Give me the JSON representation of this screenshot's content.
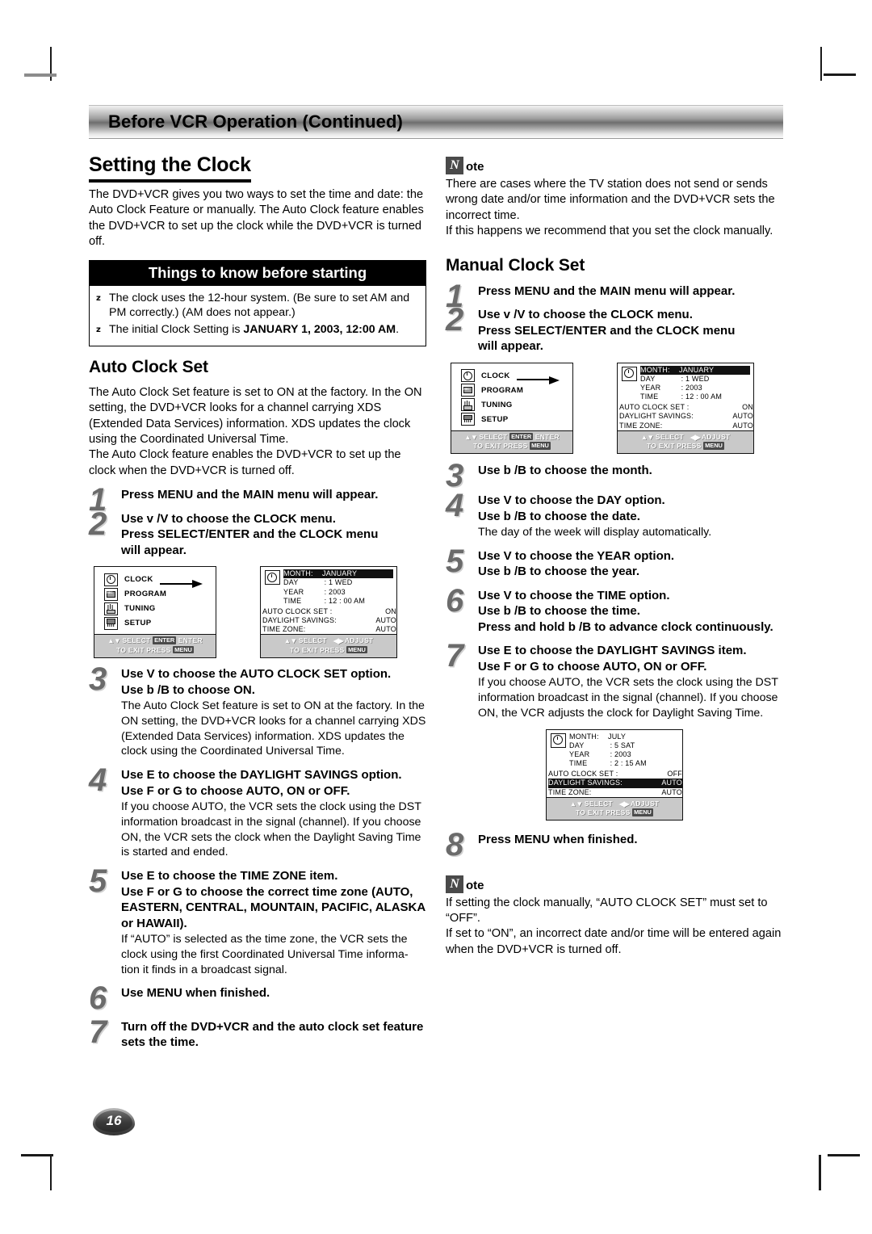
{
  "banner": {
    "title": "Before VCR Operation (Continued)"
  },
  "left": {
    "section_title": "Setting the Clock",
    "intro": "The DVD+VCR gives you two ways to set the time and date: the Auto Clock Feature or manually. The Auto Clock feature enables the DVD+VCR to set up the clock while the DVD+VCR is turned off.",
    "tipbox": {
      "bar_title": "Things to know before starting",
      "bullet_glyph": "z",
      "items": [
        {
          "text": "The clock uses the 12-hour system. (Be sure to set AM and PM correctly.) (AM does not appear.)",
          "bold": ""
        },
        {
          "text": "The initial Clock Setting is ",
          "bold": "JANUARY 1, 2003, 12:00 AM",
          "after": "."
        }
      ]
    },
    "auto_title": "Auto Clock Set",
    "auto_intro_1": "The Auto Clock Set feature is set to ON at the factory. In the ON setting, the DVD+VCR looks for a channel carrying XDS (Extended Data Services) information. XDS updates the clock using the Coordinated Universal Time.",
    "auto_intro_2": "The Auto Clock feature enables the DVD+VCR to set up the clock when the DVD+VCR is turned off.",
    "steps": [
      {
        "num": "1",
        "lead": "Press MENU and the MAIN menu will appear.",
        "lead2": "",
        "lead3": "",
        "note": ""
      },
      {
        "num": "2",
        "lead": "Use v /V to choose the CLOCK menu.",
        "lead2": "Press SELECT/ENTER and the CLOCK menu",
        "lead3": "will appear.",
        "note": ""
      },
      {
        "num": "3",
        "lead": "Use V to choose the AUTO CLOCK SET option.",
        "lead2": "Use b /B to choose ON.",
        "lead3": "",
        "note": "The Auto Clock Set feature is set to ON at the factory. In the ON setting, the DVD+VCR looks for a channel carrying XDS (Extended Data Services) information. XDS updates the clock using the Coordinated Universal Time."
      },
      {
        "num": "4",
        "lead": "Use E to choose the DAYLIGHT SAVINGS option.",
        "lead2": "Use F or G to choose AUTO, ON or OFF.",
        "lead3": "",
        "note": "If you choose AUTO, the VCR sets the clock using the DST information broadcast in the signal (channel). If you choose ON, the VCR sets the clock when the Daylight Saving Time is started and ended."
      },
      {
        "num": "5",
        "lead": "Use E to choose the TIME ZONE item.",
        "lead2": "Use F or G to choose the correct time zone (AUTO, EASTERN, CENTRAL, MOUNTAIN, PACIFIC, ALASKA or HAWAII).",
        "lead3": "",
        "note": "If “AUTO” is selected as the time zone, the VCR sets the clock using the first Coordinated Universal Time informa-tion it finds in a broadcast signal."
      },
      {
        "num": "6",
        "lead": "Use MENU when finished.",
        "lead2": "",
        "lead3": "",
        "note": ""
      },
      {
        "num": "7",
        "lead": "Turn off the DVD+VCR and the auto clock set feature sets the time.",
        "lead2": "",
        "lead3": "",
        "note": ""
      }
    ]
  },
  "right": {
    "note_top": {
      "badge": "N",
      "label": "ote",
      "p1": "There are cases where the TV station does not send or sends wrong date and/or time information and the DVD+VCR sets the incorrect time.",
      "p2": "If this happens we recommend that you set the clock manually."
    },
    "manual_title": "Manual Clock Set",
    "steps": [
      {
        "num": "1",
        "lead": "Press MENU and the MAIN menu will appear.",
        "lead2": "",
        "lead3": "",
        "note": ""
      },
      {
        "num": "2",
        "lead": "Use v /V to choose the CLOCK menu.",
        "lead2": "Press SELECT/ENTER and the CLOCK menu",
        "lead3": "will appear.",
        "note": ""
      },
      {
        "num": "3",
        "lead": "Use b /B to choose the month.",
        "lead2": "",
        "lead3": "",
        "note": ""
      },
      {
        "num": "4",
        "lead": "Use V to choose the DAY option.",
        "lead2": "Use b /B to choose the date.",
        "lead3": "",
        "note": "The day of the week will display automatically."
      },
      {
        "num": "5",
        "lead": "Use V to choose the YEAR option.",
        "lead2": "Use b /B to choose the year.",
        "lead3": "",
        "note": ""
      },
      {
        "num": "6",
        "lead": "Use V to choose the TIME option.",
        "lead2": "Use b /B to choose the time.",
        "lead3": "Press and hold b /B to advance clock continuously.",
        "note": ""
      },
      {
        "num": "7",
        "lead": "Use E to choose the DAYLIGHT SAVINGS item.",
        "lead2": "Use F or G to choose AUTO, ON or OFF.",
        "lead3": "",
        "note": "If you choose AUTO, the VCR sets the clock using the DST information broadcast in the signal (channel). If you choose ON, the VCR adjusts the clock for Daylight Saving Time."
      },
      {
        "num": "8",
        "lead": "Press MENU when finished.",
        "lead2": "",
        "lead3": "",
        "note": ""
      }
    ],
    "note_bottom": {
      "badge": "N",
      "label": "ote",
      "p1": "If setting the clock manually, “AUTO CLOCK SET” must set to “OFF”.",
      "p2": "If set to “ON”, an incorrect date and/or time will be entered again when the DVD+VCR is turned off."
    }
  },
  "osd": {
    "main_menu": {
      "items": [
        {
          "icon": "clock-icon",
          "label": "CLOCK"
        },
        {
          "icon": "record-icon",
          "label": "PROGRAM"
        },
        {
          "icon": "antenna-icon",
          "label": "TUNING"
        },
        {
          "icon": "setup-icon",
          "label": "SETUP"
        }
      ],
      "footer_line1_a": "SELECT",
      "footer_key1": "ENTER",
      "footer_line1_b": "ENTER",
      "footer_line2_a": "TO EXIT PRESS",
      "footer_key2": "MENU"
    },
    "clock_january": {
      "month_key": "MONTH:",
      "month_value": "JANUARY",
      "day_key": "DAY",
      "day_value": "1  WED",
      "year_key": "YEAR",
      "year_value": "2003",
      "time_key": "TIME",
      "time_value": "12 : 00  AM",
      "auto_clock_key": "AUTO CLOCK SET :",
      "auto_clock_value": "ON",
      "dst_key": "DAYLIGHT SAVINGS:",
      "dst_value": "AUTO",
      "tz_key": "TIME ZONE:",
      "tz_value": "AUTO",
      "footer_line1_a": "SELECT",
      "footer_line1_b": "ADJUST",
      "footer_line2_a": "TO EXIT PRESS",
      "footer_key2": "MENU"
    },
    "clock_july": {
      "month_key": "MONTH:",
      "month_value": "JULY",
      "day_key": "DAY",
      "day_value": "5  SAT",
      "year_key": "YEAR",
      "year_value": "2003",
      "time_key": "TIME",
      "time_value": "2 : 15  AM",
      "auto_clock_key": "AUTO CLOCK SET :",
      "auto_clock_value": "OFF",
      "dst_key": "DAYLIGHT SAVINGS:",
      "dst_value": "AUTO",
      "tz_key": "TIME ZONE:",
      "tz_value": "AUTO",
      "footer_line1_a": "SELECT",
      "footer_line1_b": "ADJUST",
      "footer_line2_a": "TO EXIT PRESS",
      "footer_key2": "MENU"
    }
  },
  "page_number": "16"
}
